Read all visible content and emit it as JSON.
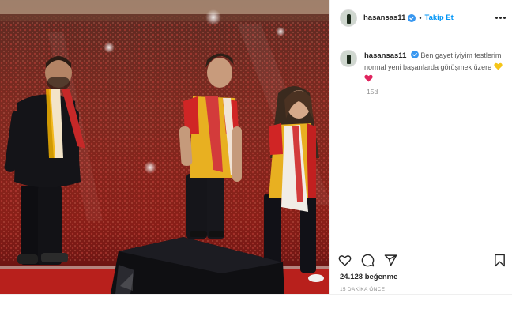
{
  "header": {
    "username": "hasansas11",
    "separator": "•",
    "follow_label": "Takip Et",
    "more_icon": "ellipsis-icon"
  },
  "caption": {
    "username": "hasansas11",
    "text": "Ben gayet iyiyim testlerim normal yeni başarılarda görüşmek üzere",
    "emojis": [
      "yellow-heart",
      "red-heart"
    ],
    "age": "15d"
  },
  "actions": {
    "icons": [
      "heart-icon",
      "comment-icon",
      "share-icon",
      "bookmark-icon"
    ],
    "likes": "24.128 beğenme",
    "posted_ago": "15 DAKİKA ÖNCE"
  },
  "colors": {
    "link": "#0095f6",
    "text": "#262626",
    "muted": "#8e8e8e",
    "verified": "#3897f0",
    "yellow_heart": "#f5c518",
    "red_heart": "#e0245e"
  }
}
